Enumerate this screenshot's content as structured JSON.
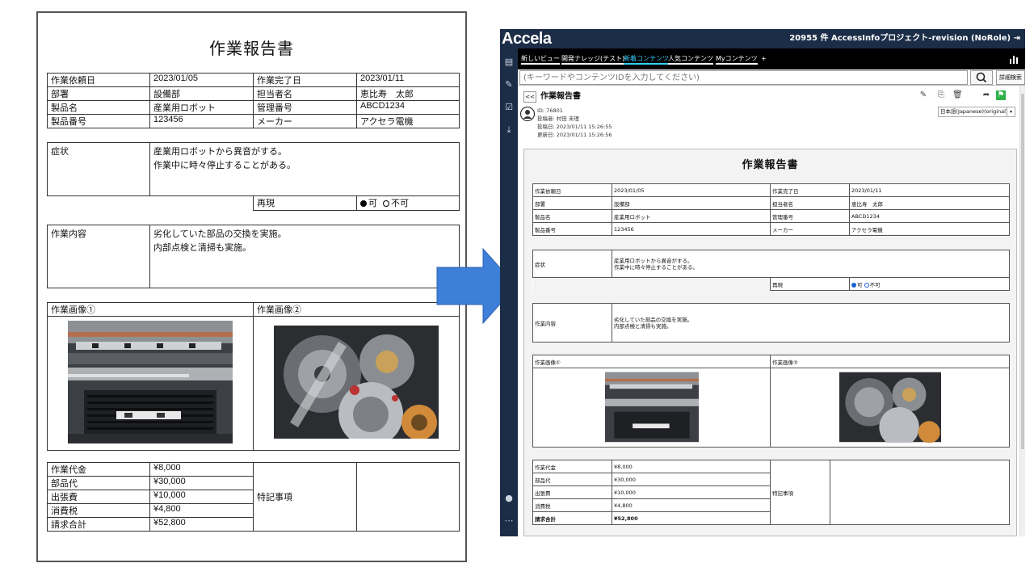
{
  "report": {
    "title": "作業報告書",
    "fields": {
      "request_date_label": "作業依頼日",
      "request_date": "2023/01/05",
      "complete_date_label": "作業完了日",
      "complete_date": "2023/01/11",
      "dept_label": "部署",
      "dept": "設備部",
      "person_label": "担当者名",
      "person": "恵比寿　太郎",
      "product_label": "製品名",
      "product": "産業用ロボット",
      "mgmt_label": "管理番号",
      "mgmt": "ABCD1234",
      "product_no_label": "製品番号",
      "product_no": "123456",
      "maker_label": "メーカー",
      "maker": "アクセラ電機"
    },
    "symptom_label": "症状",
    "symptom_line1": "産業用ロボットから異音がする。",
    "symptom_line2": "作業中に時々停止することがある。",
    "repro_label": "再現",
    "repro_yes": "可",
    "repro_no": "不可",
    "work_label": "作業内容",
    "work_line1": "劣化していた部品の交換を実施。",
    "work_line2": "内部点検と清掃も実施。",
    "image1_label": "作業画像①",
    "image2_label": "作業画像②",
    "costs": [
      {
        "label": "作業代金",
        "value": "¥8,000"
      },
      {
        "label": "部品代",
        "value": "¥30,000"
      },
      {
        "label": "出張費",
        "value": "¥10,000"
      },
      {
        "label": "消費税",
        "value": "¥4,800"
      },
      {
        "label": "請求合計",
        "value": "¥52,800"
      }
    ],
    "notes_label": "特記事項"
  },
  "app": {
    "logo": "Accela",
    "top_info": "20955 件  AccessInfoプロジェクト-revision (NoRole)",
    "tabs": [
      "新しいビュー",
      "開発ナレッジ(テスト)",
      "新着コンテンツ",
      "人気コンテンツ",
      "Myコンテンツ",
      "+"
    ],
    "search_placeholder": "(キーワードやコンテンツIDを入力してください)",
    "advanced_search": "詳細検索",
    "back": "<<",
    "doc_title": "作業報告書",
    "meta_id": "ID: 76801",
    "meta_author": "投稿者: 村田 未理",
    "meta_posted": "投稿日: 2023/01/11 15:26:55",
    "meta_updated": "更新日: 2023/01/11 15:26:56",
    "language": "日本語(Japanese)(original)"
  },
  "colors": {
    "navy": "#1c2d47",
    "active_tab": "#35d0ff",
    "arrow": "#3d7fd9",
    "bookmark": "#2db24a"
  }
}
